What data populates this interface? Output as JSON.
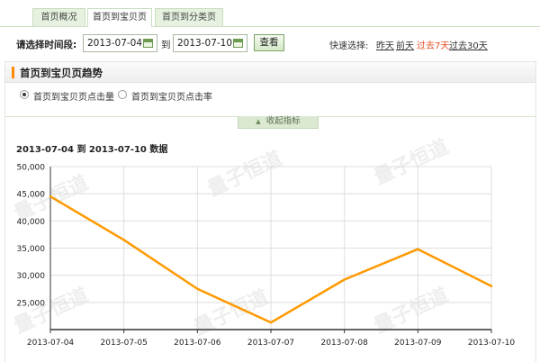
{
  "tabs": [
    {
      "label": "首页概况",
      "active": false
    },
    {
      "label": "首页到宝贝页",
      "active": true
    },
    {
      "label": "首页到分类页",
      "active": false
    }
  ],
  "date_range": {
    "label": "请选择时间段:",
    "start": "2013-07-04",
    "to_label": "到",
    "end": "2013-07-10",
    "view_button": "查看"
  },
  "quick_select": {
    "label": "快速选择:",
    "options": [
      {
        "label": "昨天",
        "selected": false
      },
      {
        "label": "前天",
        "selected": false
      },
      {
        "label": "过去7天",
        "selected": true
      },
      {
        "label": "过去30天",
        "selected": false
      }
    ]
  },
  "panel": {
    "title": "首页到宝贝页趋势",
    "metrics": [
      {
        "label": "首页到宝贝页点击量",
        "checked": true
      },
      {
        "label": "首页到宝贝页点击率",
        "checked": false
      }
    ],
    "collapse_label": "收起指标",
    "chart_heading": "2013-07-04 到 2013-07-10 数据"
  },
  "watermark": "量子恒道",
  "colors": {
    "line": "#ff9900",
    "accent_bar": "#ff8a00",
    "tab_bg": "#e6f2df",
    "selected_quick": "#e84c22"
  },
  "chart_data": {
    "type": "line",
    "categories": [
      "2013-07-04",
      "2013-07-05",
      "2013-07-06",
      "2013-07-07",
      "2013-07-08",
      "2013-07-09",
      "2013-07-10"
    ],
    "values": [
      44500,
      36500,
      27500,
      21300,
      29200,
      34800,
      28000
    ],
    "y_ticks": [
      "25,000",
      "30,000",
      "35,000",
      "40,000",
      "45,000",
      "50,000"
    ],
    "ylim": [
      20000,
      50000
    ],
    "grid": true
  }
}
